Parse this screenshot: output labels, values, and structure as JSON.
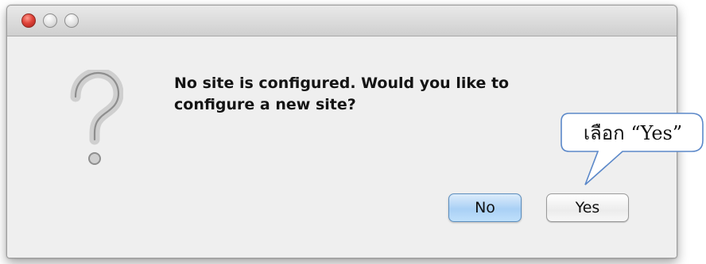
{
  "window": {
    "controls": [
      "close",
      "minimize",
      "zoom"
    ]
  },
  "dialog": {
    "icon": "question-mark-icon",
    "message_line1": "No site is configured. Would you like to",
    "message_line2": "configure a new site?",
    "buttons": {
      "no_label": "No",
      "yes_label": "Yes"
    }
  },
  "annotation": {
    "callout_text": "เลือก “Yes”"
  },
  "colors": {
    "close": "#e0443a",
    "default_button": "#a9d0f5",
    "callout_stroke": "#5b88c9"
  }
}
